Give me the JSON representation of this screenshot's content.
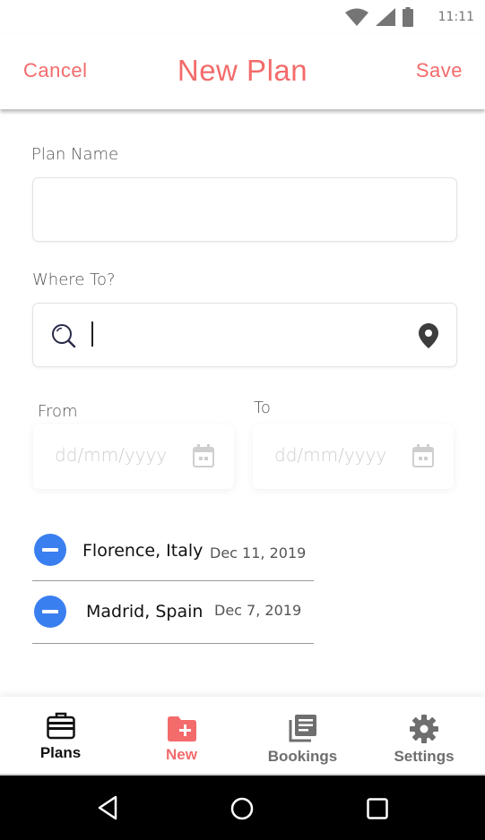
{
  "status_bar": {
    "time": "11:11"
  },
  "header": {
    "cancel_label": "Cancel",
    "title": "New Plan",
    "save_label": "Save"
  },
  "form": {
    "plan_name_label": "Plan Name",
    "plan_name_value": "",
    "where_to_label": "Where To?",
    "where_to_value": "",
    "from_label": "From",
    "from_placeholder": "dd/mm/yyyy",
    "to_label": "To",
    "to_placeholder": "dd/mm/yyyy"
  },
  "destinations": [
    {
      "name": "Florence, Italy",
      "date": "Dec 11, 2019"
    },
    {
      "name": "Madrid, Spain",
      "date": "Dec 7, 2019"
    }
  ],
  "tabs": [
    {
      "label": "Plans",
      "icon": "briefcase-icon",
      "color": "#111111"
    },
    {
      "label": "New",
      "icon": "folder-plus-icon",
      "color": "#f36b6b"
    },
    {
      "label": "Bookings",
      "icon": "library-books-icon",
      "color": "#6e6e6e"
    },
    {
      "label": "Settings",
      "icon": "gear-icon",
      "color": "#6e6e6e"
    }
  ],
  "colors": {
    "accent": "#f36b6b",
    "remove_button": "#3a7ff0",
    "text_primary": "#111111"
  }
}
